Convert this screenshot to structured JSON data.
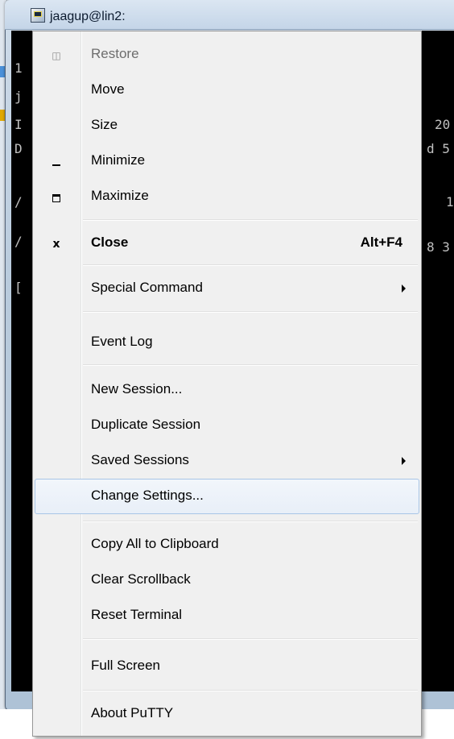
{
  "window": {
    "title": "jaagup@lin2:",
    "terminal_lines": [
      "1",
      "j",
      "I",
      "D",
      "/",
      "/",
      "[",
      "20",
      "d 5",
      "1",
      "8 3"
    ]
  },
  "menu": {
    "restore": "Restore",
    "move": "Move",
    "size": "Size",
    "minimize": "Minimize",
    "maximize": "Maximize",
    "close": "Close",
    "close_accel": "Alt+F4",
    "special_command": "Special Command",
    "event_log": "Event Log",
    "new_session": "New Session...",
    "duplicate_session": "Duplicate Session",
    "saved_sessions": "Saved Sessions",
    "change_settings": "Change Settings...",
    "copy_all": "Copy All to Clipboard",
    "clear_scrollback": "Clear Scrollback",
    "reset_terminal": "Reset Terminal",
    "full_screen": "Full Screen",
    "about": "About PuTTY",
    "highlighted_item": "Change Settings...",
    "icons": {
      "restore": "restore-icon",
      "minimize": "minimize-icon",
      "maximize": "maximize-icon",
      "close": "close-icon"
    }
  },
  "colors": {
    "menu_bg": "#f0f0f0",
    "highlight_border": "#a8c5e6",
    "terminal_bg": "#000000",
    "disabled_text": "#6d6d6d"
  }
}
